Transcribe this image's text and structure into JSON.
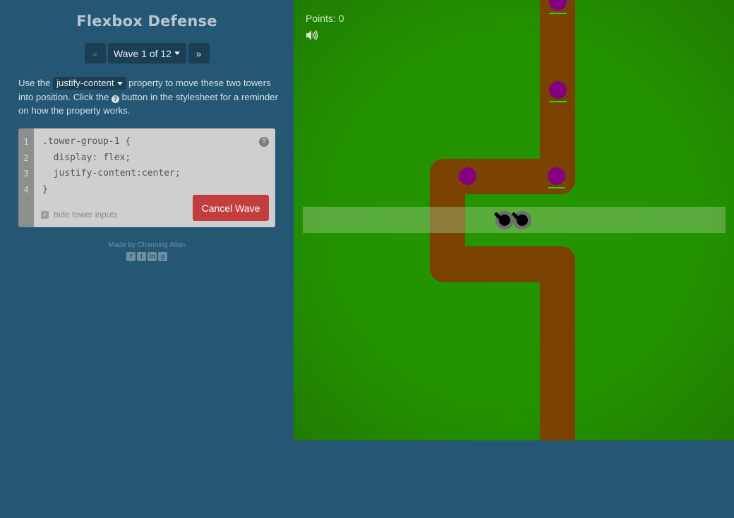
{
  "app": {
    "title": "Flexbox Defense"
  },
  "wave_nav": {
    "prev_label": "«",
    "current_label": "Wave 1 of 12",
    "next_label": "»"
  },
  "instructions": {
    "prefix": "Use the",
    "property": "justify-content",
    "middle": "property to move these two towers into position. Click the",
    "help_glyph": "?",
    "suffix": "button in the stylesheet for a reminder on how the property works."
  },
  "editor": {
    "lines": [
      {
        "number": "1",
        "code": ".tower-group-1 {"
      },
      {
        "number": "2",
        "code": "  display: flex;"
      },
      {
        "number": "3",
        "code": "  justify-content:center;"
      },
      {
        "number": "4",
        "code": "}"
      }
    ],
    "help_label": "?",
    "hide_inputs_label": "hide tower inputs",
    "hide_inputs_checked": true,
    "cancel_label": "Cancel Wave"
  },
  "footer": {
    "credit": "Made by Channing Allen",
    "social": [
      "facebook-icon",
      "twitter-icon",
      "linkedin-icon",
      "github-icon"
    ],
    "social_glyphs": [
      "f",
      "t",
      "in",
      "g"
    ]
  },
  "game": {
    "points_label": "Points: 0",
    "sound": "volume-icon",
    "colors": {
      "grass": "#249400",
      "path": "#7a4200",
      "enemy": "#820082",
      "hp_full": "#22e000",
      "hp_low": "#e00000",
      "tower": "#6d6d6d"
    },
    "enemies": [
      {
        "id": "enemy-1",
        "health": 1.0
      },
      {
        "id": "enemy-2",
        "health": 1.0
      },
      {
        "id": "enemy-3",
        "health": 1.0
      },
      {
        "id": "enemy-4",
        "health": 0.15
      }
    ],
    "towers": 2
  }
}
